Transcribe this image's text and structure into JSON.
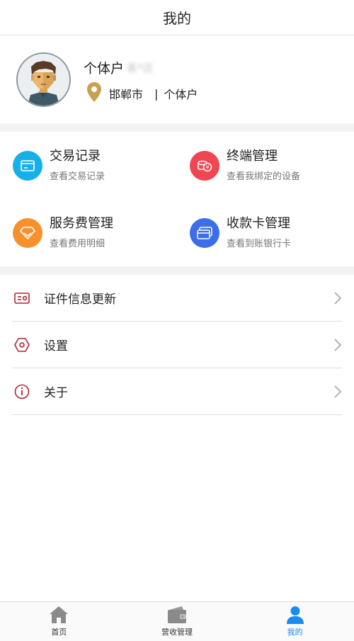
{
  "header": {
    "title": "我的"
  },
  "profile": {
    "name": "个体户",
    "name_masked": "客*店",
    "city": "邯郸市",
    "separator": "|",
    "type": "个体户"
  },
  "grid": [
    {
      "title": "交易记录",
      "subtitle": "查看交易记录",
      "icon": "card-icon",
      "color": "#17b0e6"
    },
    {
      "title": "终端管理",
      "subtitle": "查看我绑定的设备",
      "icon": "coins-icon",
      "color": "#ef4652"
    },
    {
      "title": "服务费管理",
      "subtitle": "查看费用明细",
      "icon": "diamond-icon",
      "color": "#f6912d"
    },
    {
      "title": "收款卡管理",
      "subtitle": "查看到账银行卡",
      "icon": "cards-icon",
      "color": "#3b6ee8"
    }
  ],
  "menu": [
    {
      "label": "证件信息更新",
      "icon": "id-card-icon"
    },
    {
      "label": "设置",
      "icon": "settings-icon"
    },
    {
      "label": "关于",
      "icon": "info-icon"
    }
  ],
  "tabs": [
    {
      "label": "首页",
      "icon": "home-icon"
    },
    {
      "label": "营收管理",
      "icon": "wallet-icon"
    },
    {
      "label": "我的",
      "icon": "user-icon",
      "active": true
    }
  ],
  "colors": {
    "accent": "#1a8cf0",
    "menu_icon": "#b22335",
    "pin": "#c9a04f"
  }
}
